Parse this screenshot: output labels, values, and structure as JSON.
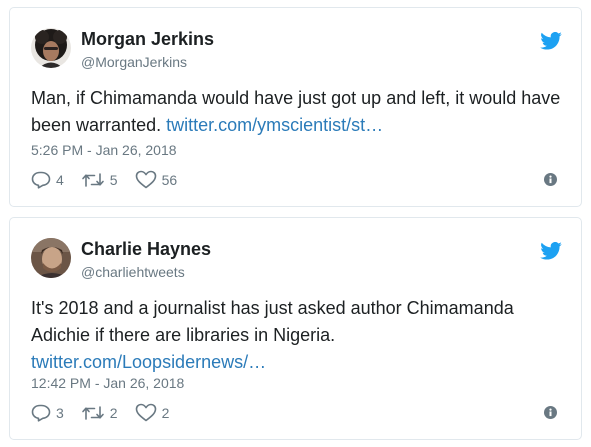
{
  "tweets": [
    {
      "author_name": "Morgan Jerkins",
      "author_handle": "@MorganJerkins",
      "text": "Man, if Chimamanda would have just got up and left, it would have been warranted. ",
      "link": "twitter.com/ymscientist/st…",
      "timestamp": "5:26 PM - Jan 26, 2018",
      "replies": "4",
      "retweets": "5",
      "likes": "56"
    },
    {
      "author_name": "Charlie Haynes",
      "author_handle": "@charliehtweets",
      "text": "It's 2018 and a journalist has just asked author Chimamanda Adichie if there are libraries in Nigeria.",
      "link": "twitter.com/Loopsidernews/…",
      "timestamp": "12:42 PM - Jan 26, 2018",
      "replies": "3",
      "retweets": "2",
      "likes": "2"
    }
  ],
  "icons": {
    "bird": "twitter-bird-icon",
    "reply": "reply-icon",
    "retweet": "retweet-icon",
    "like": "heart-icon",
    "info": "info-icon"
  },
  "colors": {
    "twitter_blue": "#1da1f2",
    "link": "#2b7bb9",
    "muted": "#697882",
    "border": "#e1e8ed"
  }
}
